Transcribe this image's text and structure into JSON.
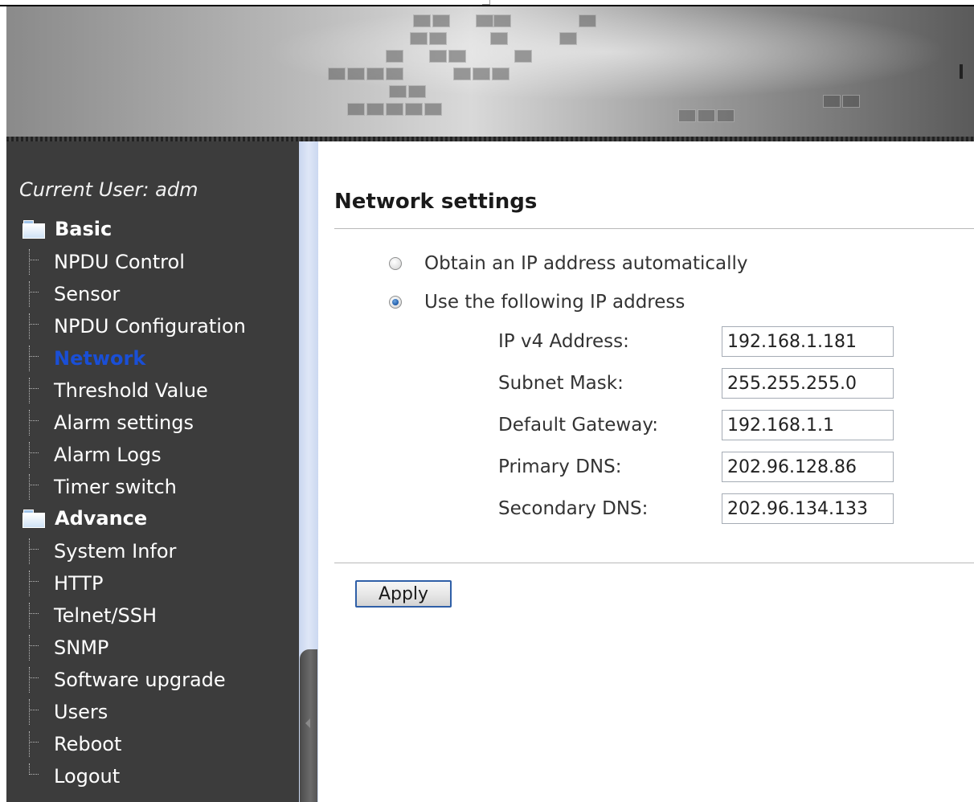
{
  "sidebar": {
    "current_user": "Current User: adm",
    "groups": [
      {
        "label": "Basic",
        "items": [
          {
            "label": "NPDU Control"
          },
          {
            "label": "Sensor"
          },
          {
            "label": "NPDU Configuration"
          },
          {
            "label": "Network",
            "active": true
          },
          {
            "label": "Threshold Value"
          },
          {
            "label": "Alarm settings"
          },
          {
            "label": "Alarm Logs"
          },
          {
            "label": "Timer switch"
          }
        ]
      },
      {
        "label": "Advance",
        "items": [
          {
            "label": "System Infor"
          },
          {
            "label": "HTTP"
          },
          {
            "label": "Telnet/SSH"
          },
          {
            "label": "SNMP"
          },
          {
            "label": "Software upgrade"
          },
          {
            "label": "Users"
          },
          {
            "label": "Reboot"
          },
          {
            "label": "Logout"
          }
        ]
      }
    ]
  },
  "main": {
    "title": "Network settings",
    "ip_mode": {
      "options": [
        {
          "label": "Obtain an IP address automatically",
          "checked": false
        },
        {
          "label": "Use the following IP address",
          "checked": true
        }
      ]
    },
    "fields": [
      {
        "label": "IP v4 Address:",
        "value": "192.168.1.181"
      },
      {
        "label": "Subnet Mask:",
        "value": "255.255.255.0"
      },
      {
        "label": "Default Gateway:",
        "value": "192.168.1.1"
      },
      {
        "label": "Primary DNS:",
        "value": "202.96.128.86"
      },
      {
        "label": "Secondary DNS:",
        "value": "202.96.134.133"
      }
    ],
    "apply_label": "Apply"
  },
  "colors": {
    "sidebar_bg": "#3c3c3c",
    "active_nav": "#1a4fd6",
    "divider": "#d4def2",
    "button_border": "#2f5fa7"
  },
  "icons": {
    "group": "folder-icon",
    "radio_checked": "radio-checked-icon",
    "radio_unchecked": "radio-unchecked-icon",
    "collapse": "collapse-arrow-icon"
  }
}
